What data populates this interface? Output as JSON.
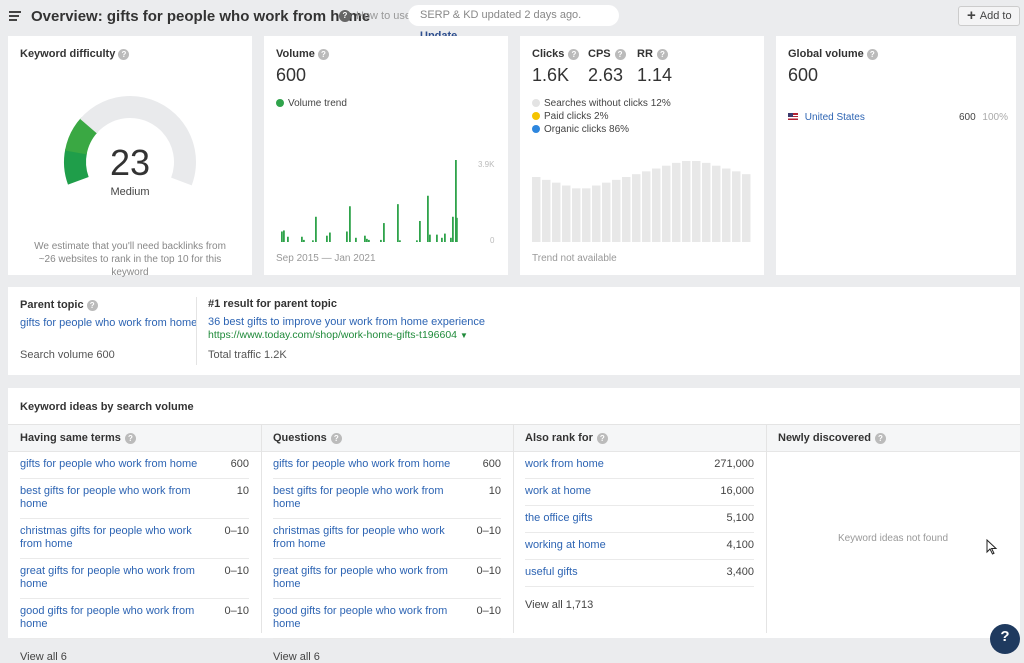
{
  "header": {
    "title": "Overview: gifts for people who work from home",
    "how_to_use": "How to use",
    "update_notice": "SERP & KD updated 2 days ago.",
    "update_link": "Update",
    "add_to_label": "Add to",
    "icons": {
      "menu": "hamburger-menu-icon",
      "help": "question-circle-icon",
      "add": "plus-icon"
    }
  },
  "keyword_difficulty": {
    "title": "Keyword difficulty",
    "value": "23",
    "level": "Medium",
    "score_fraction": 0.23,
    "gauge_color": "#2fa34b",
    "estimate_text": "We estimate that you'll need backlinks from ~26 websites to rank in the top 10 for this keyword"
  },
  "volume": {
    "title": "Volume",
    "value": "600",
    "legend": "Volume trend",
    "legend_color": "#2fa34b",
    "y_max_label": "3.9K",
    "y_min_label": "0",
    "range_label": "Sep 2015 — Jan 2021"
  },
  "clicks": {
    "metrics": [
      {
        "label": "Clicks",
        "value": "1.6K"
      },
      {
        "label": "CPS",
        "value": "2.63"
      },
      {
        "label": "RR",
        "value": "1.14"
      }
    ],
    "legend": [
      {
        "label": "Searches without clicks 12%",
        "color": "#e3e3e3"
      },
      {
        "label": "Paid clicks 2%",
        "color": "#f5c400"
      },
      {
        "label": "Organic clicks 86%",
        "color": "#2e86de"
      }
    ],
    "trend_note": "Trend not available"
  },
  "global_volume": {
    "title": "Global volume",
    "value": "600",
    "countries": [
      {
        "name": "United States",
        "flag": "us-flag-icon",
        "volume": "600",
        "share": "100%"
      }
    ]
  },
  "parent_topic": {
    "title": "Parent topic",
    "topic": "gifts for people who work from home",
    "search_volume": "Search volume 600",
    "result_title": "#1 result for parent topic",
    "result_link": "36 best gifts to improve your work from home experience",
    "result_url": "https://www.today.com/shop/work-home-gifts-t196604",
    "total_traffic": "Total traffic 1.2K"
  },
  "keyword_ideas": {
    "title": "Keyword ideas by search volume",
    "columns": [
      {
        "title": "Having same terms",
        "items": [
          {
            "keyword": "gifts for people who work from home",
            "volume": "600"
          },
          {
            "keyword": "best gifts for people who work from home",
            "volume": "10"
          },
          {
            "keyword": "christmas gifts for people who work from home",
            "volume": "0–10"
          },
          {
            "keyword": "great gifts for people who work from home",
            "volume": "0–10"
          },
          {
            "keyword": "good gifts for people who work from home",
            "volume": "0–10"
          }
        ],
        "view_all": "View all 6"
      },
      {
        "title": "Questions",
        "items": [
          {
            "keyword": "gifts for people who work from home",
            "volume": "600"
          },
          {
            "keyword": "best gifts for people who work from home",
            "volume": "10"
          },
          {
            "keyword": "christmas gifts for people who work from home",
            "volume": "0–10"
          },
          {
            "keyword": "great gifts for people who work from home",
            "volume": "0–10"
          },
          {
            "keyword": "good gifts for people who work from home",
            "volume": "0–10"
          }
        ],
        "view_all": "View all 6"
      },
      {
        "title": "Also rank for",
        "items": [
          {
            "keyword": "work from home",
            "volume": "271,000"
          },
          {
            "keyword": "work at home",
            "volume": "16,000"
          },
          {
            "keyword": "the office gifts",
            "volume": "5,100"
          },
          {
            "keyword": "working at home",
            "volume": "4,100"
          },
          {
            "keyword": "useful gifts",
            "volume": "3,400"
          }
        ],
        "view_all": "View all 1,713"
      },
      {
        "title": "Newly discovered",
        "items": [],
        "empty_text": "Keyword ideas not found"
      }
    ]
  },
  "chat_widget": {
    "label": "?"
  },
  "chart_data": [
    {
      "type": "bar",
      "title": "Volume trend",
      "xlabel": "Sep 2015 — Jan 2021",
      "ylabel": "",
      "ylim": [
        0,
        3900
      ],
      "y_tick_labels": [
        "0",
        "3.9K"
      ],
      "series": [
        {
          "name": "Volume trend",
          "color": "#2fa34b",
          "values": [
            500,
            550,
            250,
            250,
            100,
            80,
            1200,
            300,
            450,
            500,
            1700,
            200,
            300,
            150,
            100,
            100,
            900,
            1800,
            80,
            80,
            1000,
            2200,
            350,
            350,
            200,
            400,
            200,
            1200,
            3900,
            1150
          ]
        }
      ]
    },
    {
      "type": "bar",
      "title": "Clicks trend (not available)",
      "ylim": [
        0,
        100
      ],
      "series": [
        {
          "name": "Placeholder",
          "color": "#e8e8e8",
          "values": [
            69,
            66,
            63,
            60,
            57,
            57,
            60,
            63,
            66,
            69,
            72,
            75,
            78,
            81,
            84,
            86,
            86,
            84,
            81,
            78,
            75,
            72
          ]
        }
      ]
    }
  ]
}
